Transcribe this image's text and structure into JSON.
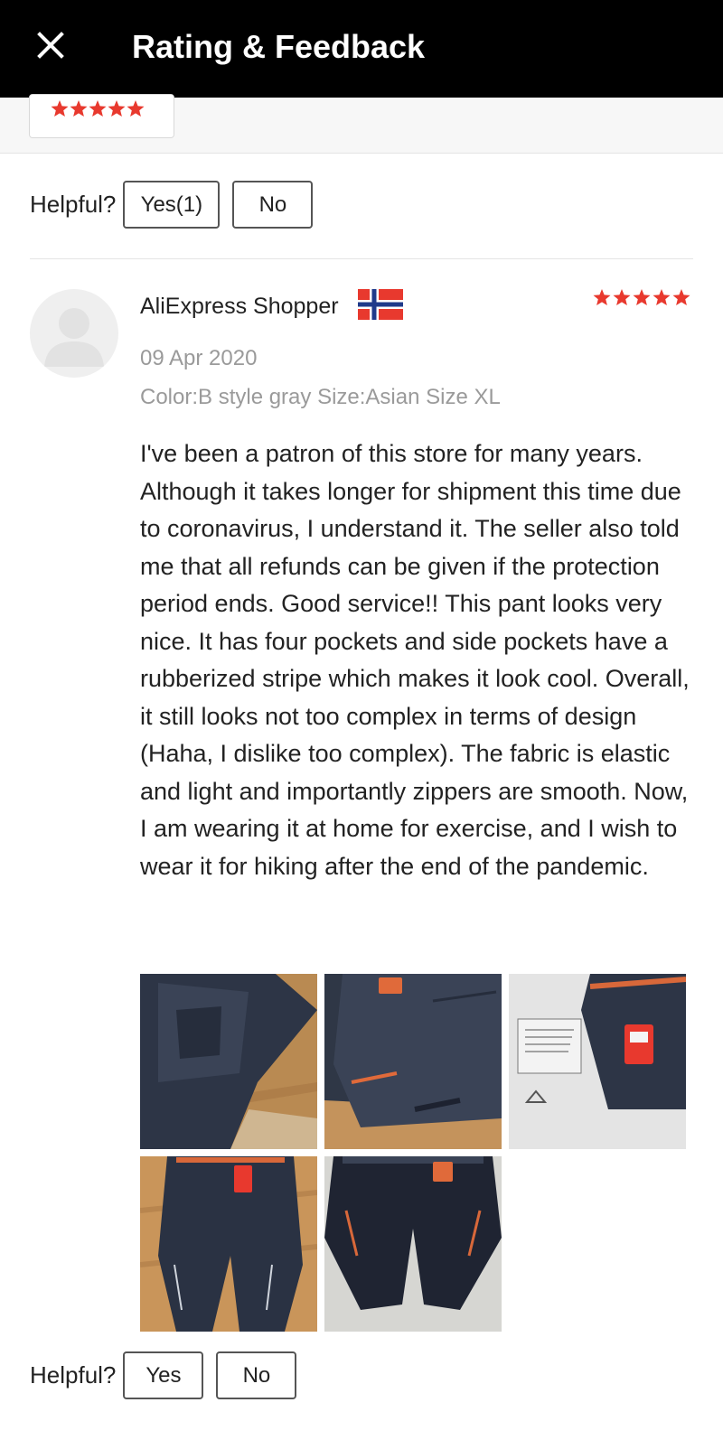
{
  "header": {
    "title": "Rating & Feedback"
  },
  "previous_review": {
    "helpful_label": "Helpful?",
    "yes_label": "Yes(1)",
    "no_label": "No"
  },
  "review": {
    "reviewer": "AliExpress Shopper",
    "country_flag": "norway-flag",
    "rating": 5,
    "date": "09 Apr 2020",
    "variant": "Color:B style gray Size:Asian Size XL",
    "text": "I've been a patron of this store for many years. Although it takes longer for shipment this time due to coronavirus, I understand it. The seller also told me that all refunds can be given if the protection period ends. Good service!! This pant looks very nice. It has four pockets and side pockets have a rubberized stripe which makes it look cool. Overall, it still looks not too complex in terms of design (Haha, I dislike too complex). The fabric is elastic and light and importantly zippers are smooth. Now, I am wearing it at home for exercise, and I wish to wear it for hiking after the end of the pandemic.",
    "photo_count": 5,
    "helpful_label": "Helpful?",
    "yes_label": "Yes",
    "no_label": "No"
  },
  "colors": {
    "star": "#e8392e",
    "header_bg": "#000000",
    "muted_text": "#9a9a9a"
  }
}
